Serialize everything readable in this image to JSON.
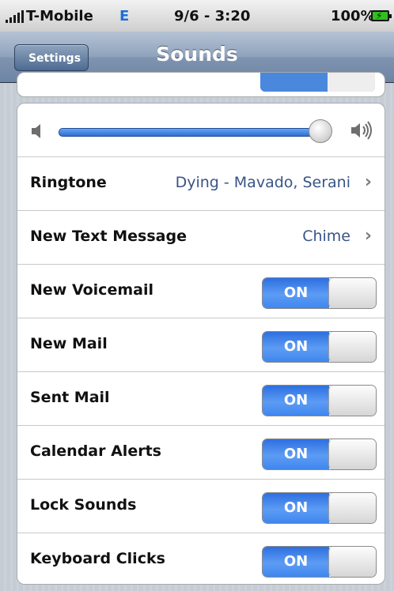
{
  "status_bar": {
    "carrier": "T-Mobile",
    "network": "E",
    "time": "9/6 - 3:20",
    "battery": "100%"
  },
  "nav": {
    "back_label": "Settings",
    "title": "Sounds"
  },
  "volume": {
    "level": 1.0
  },
  "rows": {
    "ringtone": {
      "label": "Ringtone",
      "value": "Dying - Mavado, Serani"
    },
    "new_text": {
      "label": "New Text Message",
      "value": "Chime"
    },
    "new_voicemail": {
      "label": "New Voicemail",
      "toggle": "ON"
    },
    "new_mail": {
      "label": "New Mail",
      "toggle": "ON"
    },
    "sent_mail": {
      "label": "Sent Mail",
      "toggle": "ON"
    },
    "calendar_alerts": {
      "label": "Calendar Alerts",
      "toggle": "ON"
    },
    "lock_sounds": {
      "label": "Lock Sounds",
      "toggle": "ON"
    },
    "keyboard_clicks": {
      "label": "Keyboard Clicks",
      "toggle": "ON"
    }
  },
  "colors": {
    "accent": "#2d6fd3",
    "value_text": "#385487",
    "nav_bar": "#8ea2bc"
  },
  "icons": [
    "signal-icon",
    "battery-icon",
    "chevron-right-icon",
    "volume-low-icon",
    "volume-high-icon"
  ]
}
